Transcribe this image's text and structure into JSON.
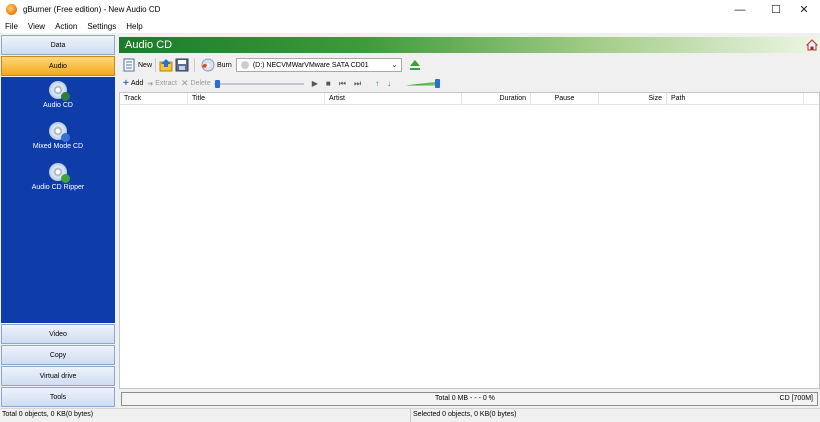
{
  "window": {
    "title": "gBurner (Free edition) - New Audio CD",
    "controls": {
      "minimize": "—",
      "maximize": "☐",
      "close": "✕"
    }
  },
  "menu": [
    "File",
    "View",
    "Action",
    "Settings",
    "Help"
  ],
  "sidebar": {
    "data": "Data",
    "audio": "Audio",
    "items": [
      {
        "label": "Audio CD",
        "icon": "audio-cd-icon"
      },
      {
        "label": "Mixed Mode CD",
        "icon": "mixed-mode-cd-icon"
      },
      {
        "label": "Audio CD Ripper",
        "icon": "audio-cd-ripper-icon"
      }
    ],
    "video": "Video",
    "copy": "Copy",
    "virtual_drive": "Virtual drive",
    "tools": "Tools"
  },
  "main": {
    "header_title": "Audio CD",
    "toolbar": {
      "new": "New",
      "burn": "Burn",
      "drive": "(D:) NECVMWarVMware SATA CD01"
    },
    "toolbar2": {
      "add": "Add",
      "extract": "Extract",
      "delete": "Delete"
    },
    "columns": [
      "Track",
      "Title",
      "Artist",
      "Duration",
      "Pause",
      "Size",
      "Path"
    ],
    "status": {
      "total": "Total  0 MB   - - -  0 %",
      "capacity": "CD [700M]"
    }
  },
  "statusbar": {
    "left": "Total 0 objects, 0 KB(0 bytes)",
    "right": "Selected 0 objects, 0 KB(0 bytes)"
  },
  "colors": {
    "accent": "#0e3ca8",
    "header": "#2f8f3a",
    "active_tab": "#f2a81e"
  }
}
